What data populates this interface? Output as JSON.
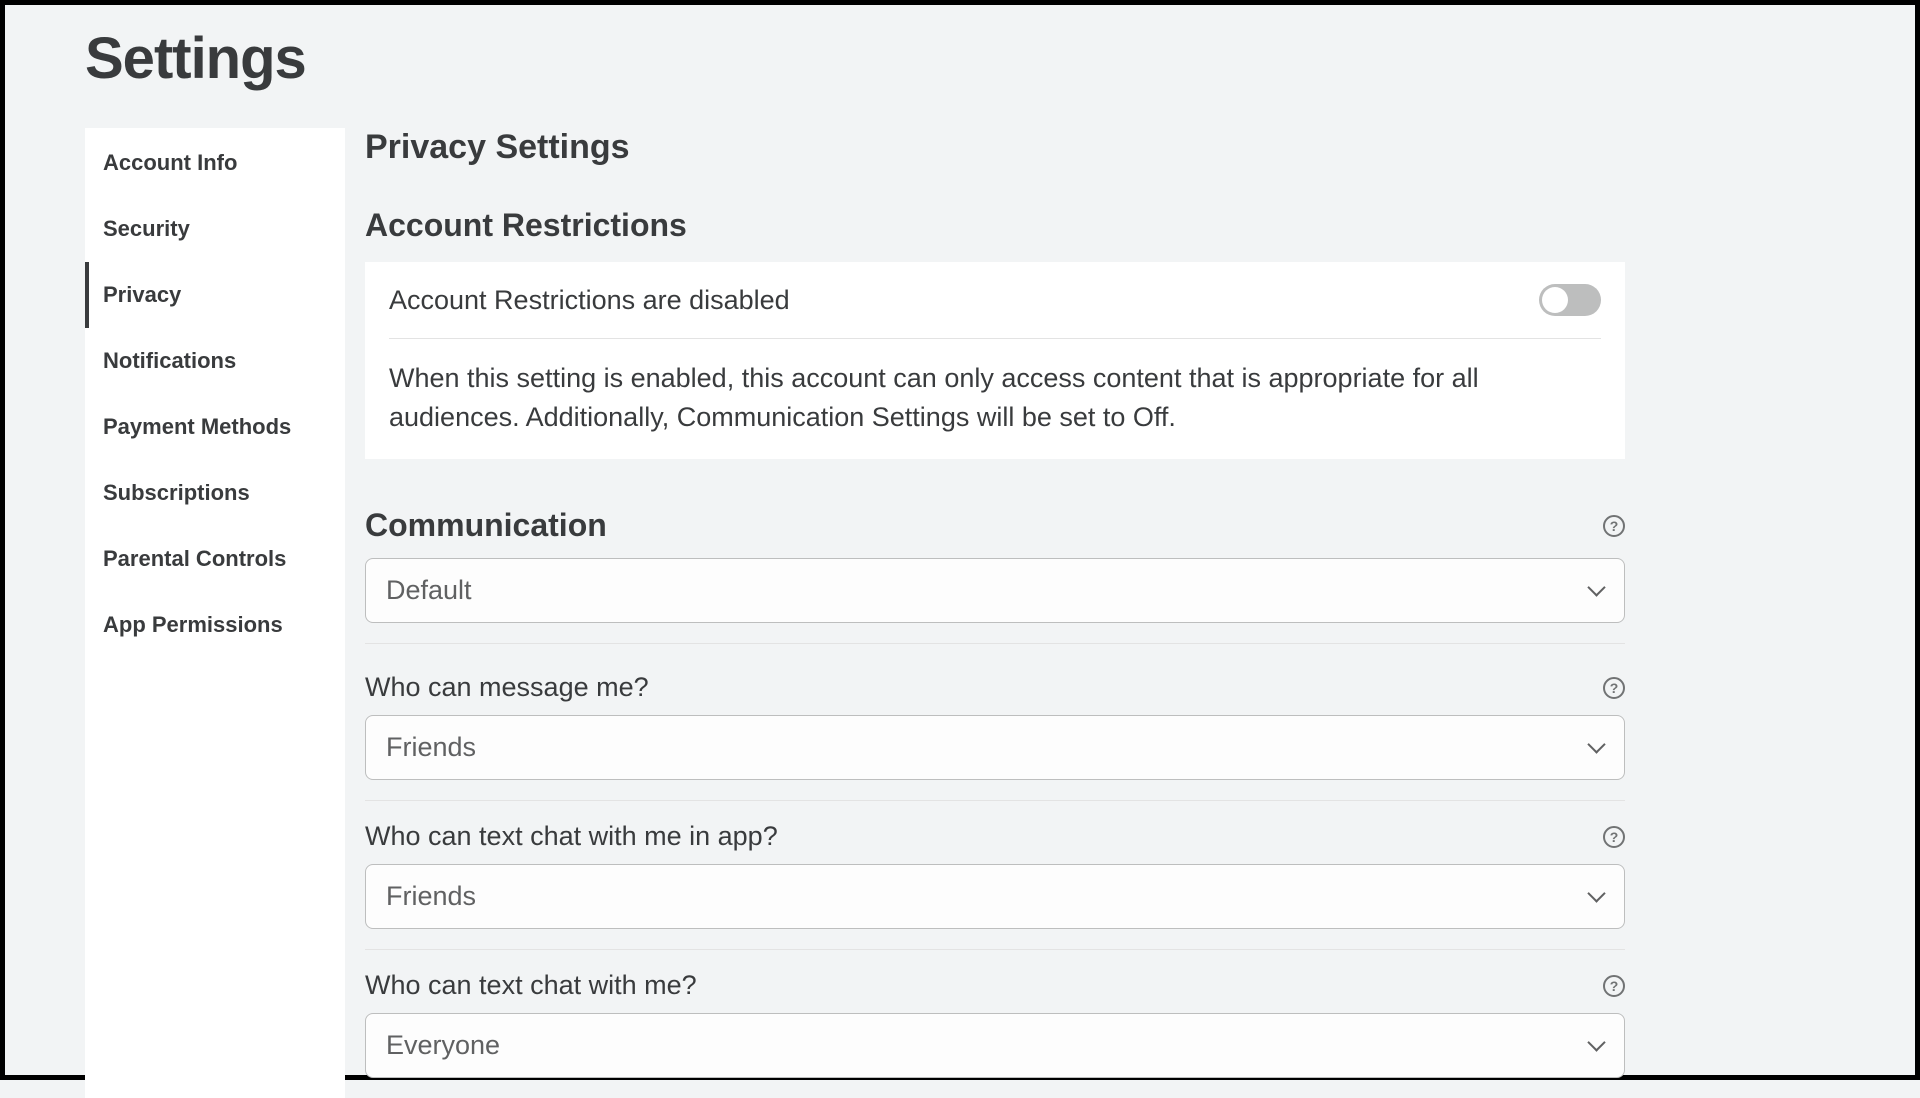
{
  "page_title": "Settings",
  "sidebar": {
    "items": [
      {
        "label": "Account Info",
        "active": false
      },
      {
        "label": "Security",
        "active": false
      },
      {
        "label": "Privacy",
        "active": true
      },
      {
        "label": "Notifications",
        "active": false
      },
      {
        "label": "Payment Methods",
        "active": false
      },
      {
        "label": "Subscriptions",
        "active": false
      },
      {
        "label": "Parental Controls",
        "active": false
      },
      {
        "label": "App Permissions",
        "active": false
      }
    ]
  },
  "main": {
    "section_title": "Privacy Settings",
    "account_restrictions": {
      "heading": "Account Restrictions",
      "status_label": "Account Restrictions are disabled",
      "toggle_on": false,
      "description": "When this setting is enabled, this account can only access content that is appropriate for all audiences. Additionally, Communication Settings will be set to Off."
    },
    "communication": {
      "heading": "Communication",
      "default_select": {
        "value": "Default"
      },
      "fields": [
        {
          "label": "Who can message me?",
          "value": "Friends"
        },
        {
          "label": "Who can text chat with me in app?",
          "value": "Friends"
        },
        {
          "label": "Who can text chat with me?",
          "value": "Everyone"
        }
      ]
    }
  }
}
